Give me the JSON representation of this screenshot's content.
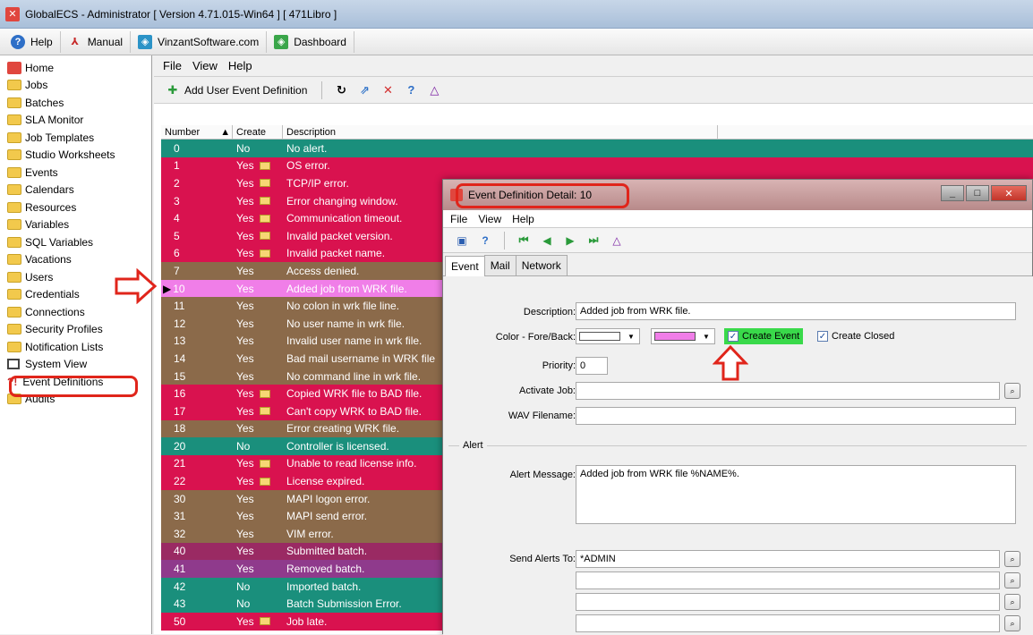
{
  "titlebar": {
    "title": "GlobalECS - Administrator [ Version 4.71.015-Win64 ] [ 471Libro ]"
  },
  "toolbar": {
    "help": "Help",
    "manual": "Manual",
    "site": "VinzantSoftware.com",
    "dashboard": "Dashboard"
  },
  "sidebar": {
    "items": [
      {
        "label": "Home",
        "icon": "home-icon"
      },
      {
        "label": "Jobs",
        "icon": "folder-icon"
      },
      {
        "label": "Batches",
        "icon": "folder-icon"
      },
      {
        "label": "SLA Monitor",
        "icon": "folder-icon"
      },
      {
        "label": "Job Templates",
        "icon": "folder-icon"
      },
      {
        "label": "Studio Worksheets",
        "icon": "folder-icon"
      },
      {
        "label": "Events",
        "icon": "folder-icon"
      },
      {
        "label": "Calendars",
        "icon": "folder-icon"
      },
      {
        "label": "Resources",
        "icon": "folder-icon"
      },
      {
        "label": "Variables",
        "icon": "folder-icon"
      },
      {
        "label": "SQL Variables",
        "icon": "folder-icon"
      },
      {
        "label": "Vacations",
        "icon": "folder-icon"
      },
      {
        "label": "Users",
        "icon": "folder-icon"
      },
      {
        "label": "Credentials",
        "icon": "folder-icon"
      },
      {
        "label": "Connections",
        "icon": "folder-icon"
      },
      {
        "label": "Security Profiles",
        "icon": "folder-icon"
      },
      {
        "label": "Notification Lists",
        "icon": "folder-icon"
      },
      {
        "label": "System View",
        "icon": "system-view-icon"
      },
      {
        "label": "Event Definitions",
        "icon": "event-definitions-icon"
      },
      {
        "label": "Audits",
        "icon": "folder-icon"
      }
    ]
  },
  "main": {
    "menu": [
      "File",
      "View",
      "Help"
    ],
    "add_label": "Add User Event Definition",
    "columns": {
      "number": "Number",
      "create": "Create",
      "description": "Description"
    },
    "rows": [
      {
        "num": "0",
        "create": "No",
        "mail": false,
        "desc": "No alert.",
        "bg": "#1a8f7c"
      },
      {
        "num": "1",
        "create": "Yes",
        "mail": true,
        "desc": "OS error.",
        "bg": "#d9124f"
      },
      {
        "num": "2",
        "create": "Yes",
        "mail": true,
        "desc": "TCP/IP error.",
        "bg": "#d9124f"
      },
      {
        "num": "3",
        "create": "Yes",
        "mail": true,
        "desc": "Error changing window.",
        "bg": "#d9124f"
      },
      {
        "num": "4",
        "create": "Yes",
        "mail": true,
        "desc": "Communication timeout.",
        "bg": "#d9124f"
      },
      {
        "num": "5",
        "create": "Yes",
        "mail": true,
        "desc": "Invalid packet version.",
        "bg": "#d9124f"
      },
      {
        "num": "6",
        "create": "Yes",
        "mail": true,
        "desc": "Invalid packet name.",
        "bg": "#d9124f"
      },
      {
        "num": "7",
        "create": "Yes",
        "mail": false,
        "desc": "Access denied.",
        "bg": "#8b6a4a"
      },
      {
        "num": "10",
        "create": "Yes",
        "mail": false,
        "desc": "Added job from WRK file.",
        "bg": "#f07ee8"
      },
      {
        "num": "11",
        "create": "Yes",
        "mail": false,
        "desc": "No colon in wrk file line.",
        "bg": "#8b6a4a"
      },
      {
        "num": "12",
        "create": "Yes",
        "mail": false,
        "desc": "No user name in wrk file.",
        "bg": "#8b6a4a"
      },
      {
        "num": "13",
        "create": "Yes",
        "mail": false,
        "desc": "Invalid user name in wrk file.",
        "bg": "#8b6a4a"
      },
      {
        "num": "14",
        "create": "Yes",
        "mail": false,
        "desc": "Bad mail username in WRK file",
        "bg": "#8b6a4a"
      },
      {
        "num": "15",
        "create": "Yes",
        "mail": false,
        "desc": "No command line in wrk file.",
        "bg": "#8b6a4a"
      },
      {
        "num": "16",
        "create": "Yes",
        "mail": true,
        "desc": "Copied WRK file to BAD file.",
        "bg": "#d9124f"
      },
      {
        "num": "17",
        "create": "Yes",
        "mail": true,
        "desc": "Can't copy WRK to BAD file.",
        "bg": "#d9124f"
      },
      {
        "num": "18",
        "create": "Yes",
        "mail": false,
        "desc": "Error creating WRK file.",
        "bg": "#8b6a4a"
      },
      {
        "num": "20",
        "create": "No",
        "mail": false,
        "desc": "Controller is licensed.",
        "bg": "#1a8f7c"
      },
      {
        "num": "21",
        "create": "Yes",
        "mail": true,
        "desc": "Unable to read license info.",
        "bg": "#d9124f"
      },
      {
        "num": "22",
        "create": "Yes",
        "mail": true,
        "desc": "License expired.",
        "bg": "#d9124f"
      },
      {
        "num": "30",
        "create": "Yes",
        "mail": false,
        "desc": "MAPI logon error.",
        "bg": "#8b6a4a"
      },
      {
        "num": "31",
        "create": "Yes",
        "mail": false,
        "desc": "MAPI send error.",
        "bg": "#8b6a4a"
      },
      {
        "num": "32",
        "create": "Yes",
        "mail": false,
        "desc": "VIM error.",
        "bg": "#8b6a4a"
      },
      {
        "num": "40",
        "create": "Yes",
        "mail": false,
        "desc": "Submitted batch.",
        "bg": "#9a2a63"
      },
      {
        "num": "41",
        "create": "Yes",
        "mail": false,
        "desc": "Removed batch.",
        "bg": "#8f3a8c"
      },
      {
        "num": "42",
        "create": "No",
        "mail": false,
        "desc": "Imported batch.",
        "bg": "#1a8f7c"
      },
      {
        "num": "43",
        "create": "No",
        "mail": false,
        "desc": "Batch Submission Error.",
        "bg": "#1a8f7c"
      },
      {
        "num": "50",
        "create": "Yes",
        "mail": true,
        "desc": "Job late.",
        "bg": "#d9124f"
      }
    ]
  },
  "dialog": {
    "title": "Event Definition Detail: 10",
    "menu": [
      "File",
      "View",
      "Help"
    ],
    "tabs": [
      "Event",
      "Mail",
      "Network"
    ],
    "labels": {
      "description": "Description:",
      "color": "Color - Fore/Back:",
      "priority": "Priority:",
      "activate_job": "Activate Job:",
      "wav": "WAV Filename:",
      "alert_group": "Alert",
      "alert_message": "Alert Message:",
      "send_alerts": "Send Alerts To:"
    },
    "values": {
      "description": "Added job from WRK file.",
      "priority": "0",
      "activate_job": "",
      "wav": "",
      "alert_message": "Added job from WRK file %NAME%.",
      "send_alerts": [
        "*ADMIN",
        "",
        "",
        ""
      ]
    },
    "colors": {
      "fore": "#ffffff",
      "back": "#f07ee8"
    },
    "checkboxes": {
      "create_event": "Create Event",
      "create_closed": "Create Closed"
    }
  }
}
